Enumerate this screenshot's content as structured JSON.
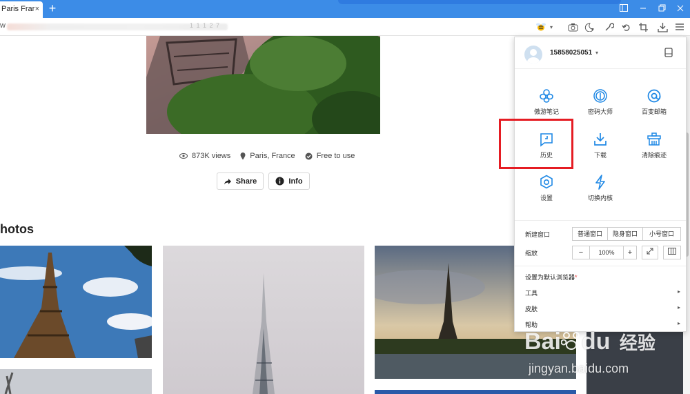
{
  "browser": {
    "tab_title": "Paris Frar",
    "tab_close": "×",
    "new_tab": "+",
    "url_partial_left": "w",
    "url_partial_right": "1 1 1 2 7"
  },
  "page": {
    "views": "873K views",
    "location": "Paris, France",
    "license": "Free to use",
    "share_label": "Share",
    "info_label": "Info",
    "section_heading": "hotos"
  },
  "menu": {
    "username": "15858025051",
    "username_caret": "▾",
    "grid": [
      {
        "label": "傲游笔记",
        "icon": "notes-icon"
      },
      {
        "label": "密码大师",
        "icon": "fingerprint-icon"
      },
      {
        "label": "百变邮箱",
        "icon": "email-icon"
      },
      {
        "label": "历史",
        "icon": "history-icon"
      },
      {
        "label": "下载",
        "icon": "download-icon"
      },
      {
        "label": "清除痕迹",
        "icon": "clean-icon"
      },
      {
        "label": "设置",
        "icon": "settings-icon"
      },
      {
        "label": "切换内核",
        "icon": "engine-switch-icon"
      }
    ],
    "new_window_label": "新建窗口",
    "new_window_options": [
      "普通窗口",
      "隐身窗口",
      "小号窗口"
    ],
    "zoom_label": "缩放",
    "zoom_minus": "−",
    "zoom_value": "100%",
    "zoom_plus": "+",
    "default_browser": "设置为默认浏览器",
    "default_browser_mark": "*",
    "tools": "工具",
    "skin": "皮肤",
    "help": "帮助",
    "arrow": "▸"
  },
  "watermark": {
    "brand": "Bai",
    "brand2": "du",
    "cn": "经验",
    "site": "jingyan.baidu.com"
  },
  "colors": {
    "tabbar": "#3c8ce7",
    "accent_icon": "#1e88e5",
    "highlight": "#e51c23"
  }
}
